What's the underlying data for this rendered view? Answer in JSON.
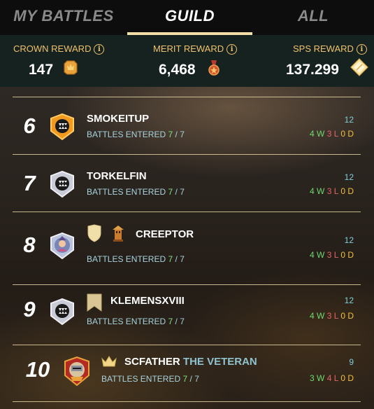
{
  "tabs": [
    {
      "label": "MY BATTLES",
      "active": false
    },
    {
      "label": "GUILD",
      "active": true
    },
    {
      "label": "ALL",
      "active": false
    }
  ],
  "rewards": [
    {
      "label": "CROWN REWARD",
      "value": "147",
      "icon": "crown-token-icon"
    },
    {
      "label": "MERIT REWARD",
      "value": "6,468",
      "icon": "merit-medal-icon"
    },
    {
      "label": "SPS REWARD",
      "value": "137.299",
      "icon": "sps-crystal-icon"
    }
  ],
  "battles_label": "BATTLES ENTERED",
  "players": [
    {
      "rank": "6",
      "name": "SMOKEITUP",
      "title": "",
      "entered": "7",
      "total": "7",
      "count": "12",
      "wins": "4",
      "losses": "3",
      "draws": "0",
      "avatar": "fangs-emblem-orange"
    },
    {
      "rank": "7",
      "name": "TORKELFIN",
      "title": "",
      "entered": "7",
      "total": "7",
      "count": "12",
      "wins": "4",
      "losses": "3",
      "draws": "0",
      "avatar": "fangs-emblem-silver"
    },
    {
      "rank": "8",
      "name": "CREEPTOR",
      "title": "",
      "entered": "7",
      "total": "7",
      "count": "12",
      "wins": "4",
      "losses": "3",
      "draws": "0",
      "avatar": "wizard-emblem",
      "badges": [
        "shield-badge-icon",
        "totem-badge-icon"
      ]
    },
    {
      "rank": "9",
      "name": "KLEMENSXVIII",
      "title": "",
      "entered": "7",
      "total": "7",
      "count": "12",
      "wins": "4",
      "losses": "3",
      "draws": "0",
      "avatar": "fangs-emblem-silver",
      "badges": [
        "banner-badge-icon"
      ]
    },
    {
      "rank": "10",
      "name": "SCFATHER",
      "title": "THE VETERAN",
      "entered": "7",
      "total": "7",
      "count": "9",
      "wins": "3",
      "losses": "4",
      "draws": "0",
      "avatar": "knight-emblem",
      "badges": [
        "crown-badge-icon"
      ]
    }
  ],
  "colors": {
    "win": "#6fd86f",
    "loss": "#e26464",
    "draw": "#f0c040",
    "reward_label": "#f0c26e",
    "tab_underline": "#f3e0a8"
  }
}
